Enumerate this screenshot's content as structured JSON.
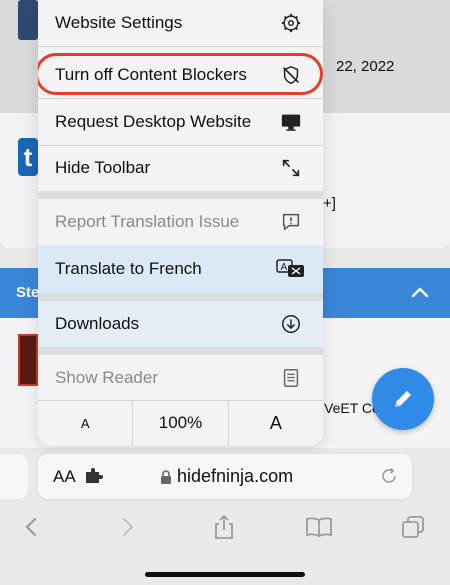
{
  "background": {
    "date_text": "22, 2022",
    "bracket_text": "+]",
    "blue_bar_text": "Ste",
    "thumb_letter": "t",
    "veet_text": "VeET Co"
  },
  "menu": {
    "website_settings": "Website Settings",
    "content_blockers": "Turn off Content Blockers",
    "request_desktop": "Request Desktop Website",
    "hide_toolbar": "Hide Toolbar",
    "report_translation": "Report Translation Issue",
    "translate": "Translate to French",
    "downloads": "Downloads",
    "show_reader": "Show Reader",
    "font_small": "A",
    "zoom": "100%",
    "font_large": "A"
  },
  "address_bar": {
    "aa_label": "AA",
    "url": "hidefninja.com"
  },
  "colors": {
    "highlight": "#e0412b",
    "accent": "#2f8be6"
  }
}
